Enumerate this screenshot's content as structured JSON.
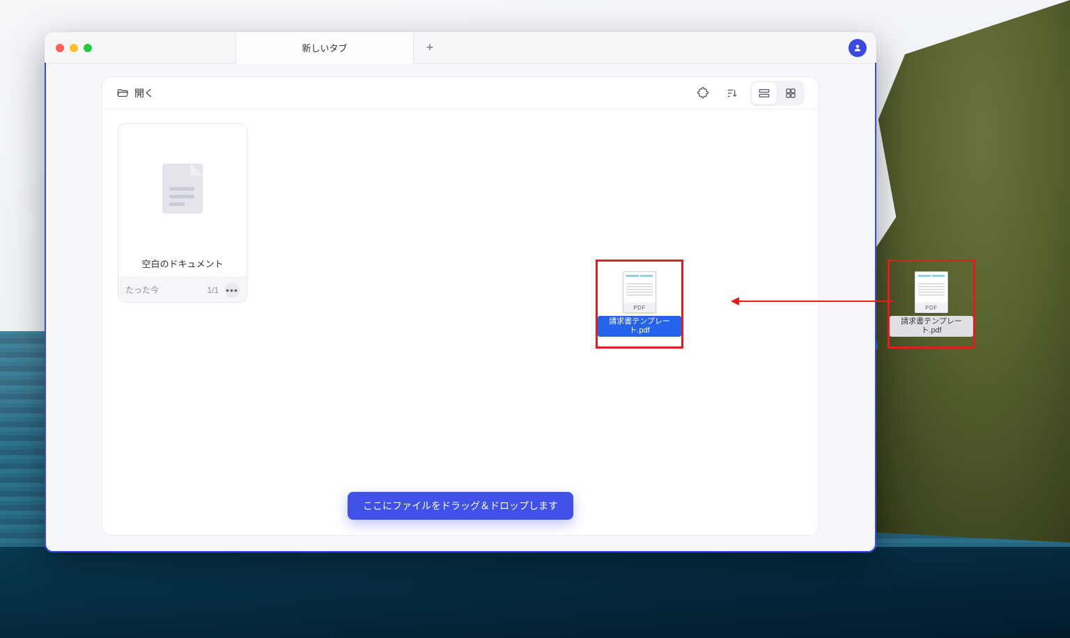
{
  "tab": {
    "title": "新しいタブ"
  },
  "toolbar": {
    "open_label": "開く"
  },
  "document_card": {
    "name": "空白のドキュメント",
    "timestamp": "たった今",
    "pages": "1/1"
  },
  "pdf_item": {
    "badge": "PDF",
    "filename": "請求書テンプレート.pdf"
  },
  "drop_toast": "ここにファイルをドラッグ＆ドロップします"
}
